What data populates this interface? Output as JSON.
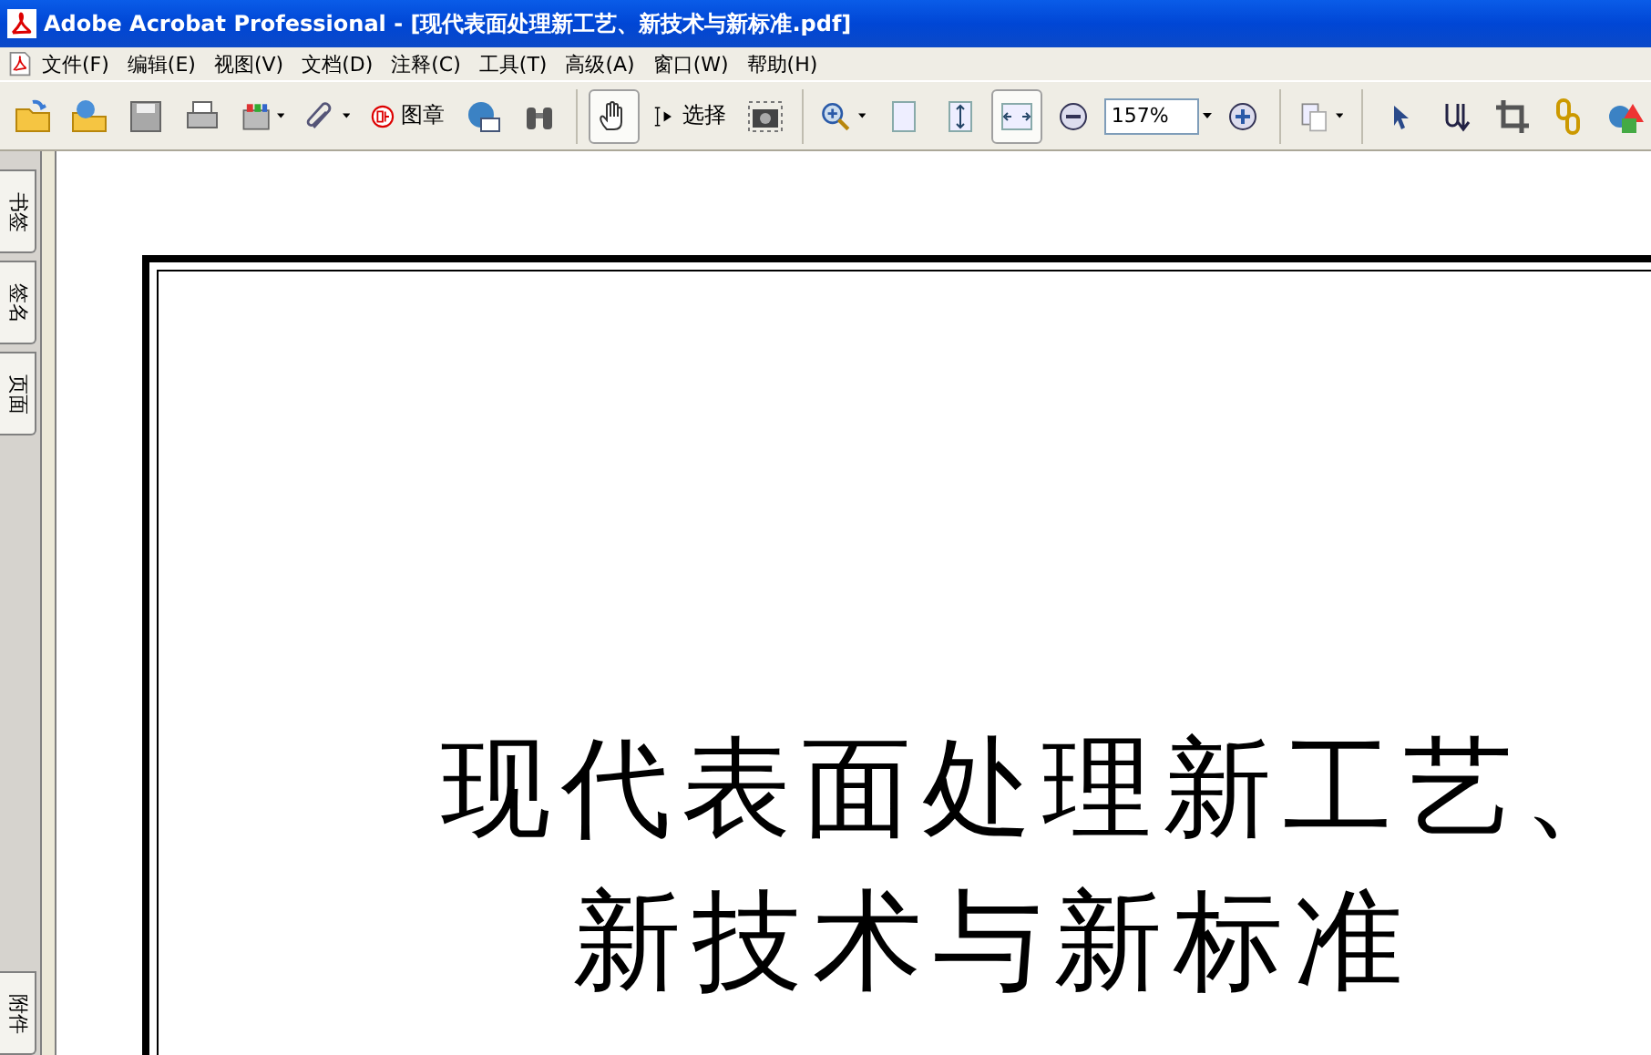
{
  "window": {
    "title": "Adobe Acrobat Professional - [现代表面处理新工艺、新技术与新标准.pdf]"
  },
  "menu": [
    "文件(F)",
    "编辑(E)",
    "视图(V)",
    "文档(D)",
    "注释(C)",
    "工具(T)",
    "高级(A)",
    "窗口(W)",
    "帮助(H)"
  ],
  "toolbar": [
    {
      "kind": "button",
      "dropdown": false,
      "selected": false
    },
    {
      "kind": "button",
      "dropdown": false,
      "selected": false
    },
    {
      "kind": "button",
      "dropdown": false,
      "selected": false
    },
    {
      "kind": "button",
      "dropdown": false,
      "selected": false
    },
    {
      "kind": "button",
      "dropdown": true,
      "selected": false
    },
    {
      "kind": "button",
      "dropdown": true,
      "selected": false
    },
    {
      "kind": "button",
      "dropdown": false,
      "selected": false,
      "label": "图章"
    },
    {
      "kind": "button",
      "dropdown": false,
      "selected": false
    },
    {
      "kind": "button",
      "dropdown": false,
      "selected": false
    },
    {
      "kind": "separator"
    },
    {
      "kind": "button",
      "dropdown": false,
      "selected": true
    },
    {
      "kind": "button",
      "dropdown": false,
      "selected": false,
      "label": "选择"
    },
    {
      "kind": "button",
      "dropdown": false,
      "selected": false
    },
    {
      "kind": "separator"
    },
    {
      "kind": "button",
      "dropdown": true,
      "selected": false
    },
    {
      "kind": "button",
      "dropdown": false,
      "selected": false
    },
    {
      "kind": "button",
      "dropdown": false,
      "selected": false
    },
    {
      "kind": "button",
      "dropdown": false,
      "selected": true
    },
    {
      "kind": "button",
      "dropdown": false,
      "selected": false
    },
    {
      "kind": "zoom",
      "value": "157%"
    },
    {
      "kind": "button",
      "dropdown": false,
      "selected": false
    },
    {
      "kind": "separator"
    },
    {
      "kind": "button",
      "dropdown": true,
      "selected": false
    },
    {
      "kind": "separator"
    },
    {
      "kind": "button",
      "dropdown": false,
      "selected": false
    },
    {
      "kind": "button",
      "dropdown": false,
      "selected": false
    },
    {
      "kind": "button",
      "dropdown": false,
      "selected": false
    },
    {
      "kind": "button",
      "dropdown": false,
      "selected": false
    },
    {
      "kind": "button",
      "dropdown": false,
      "selected": false
    }
  ],
  "side_tabs_top": [
    "书签",
    "签名",
    "页面"
  ],
  "side_tabs_bottom": [
    "附件"
  ],
  "document": {
    "title_lines": [
      "现代表面处理新工艺、",
      "新技术与新标准"
    ]
  }
}
